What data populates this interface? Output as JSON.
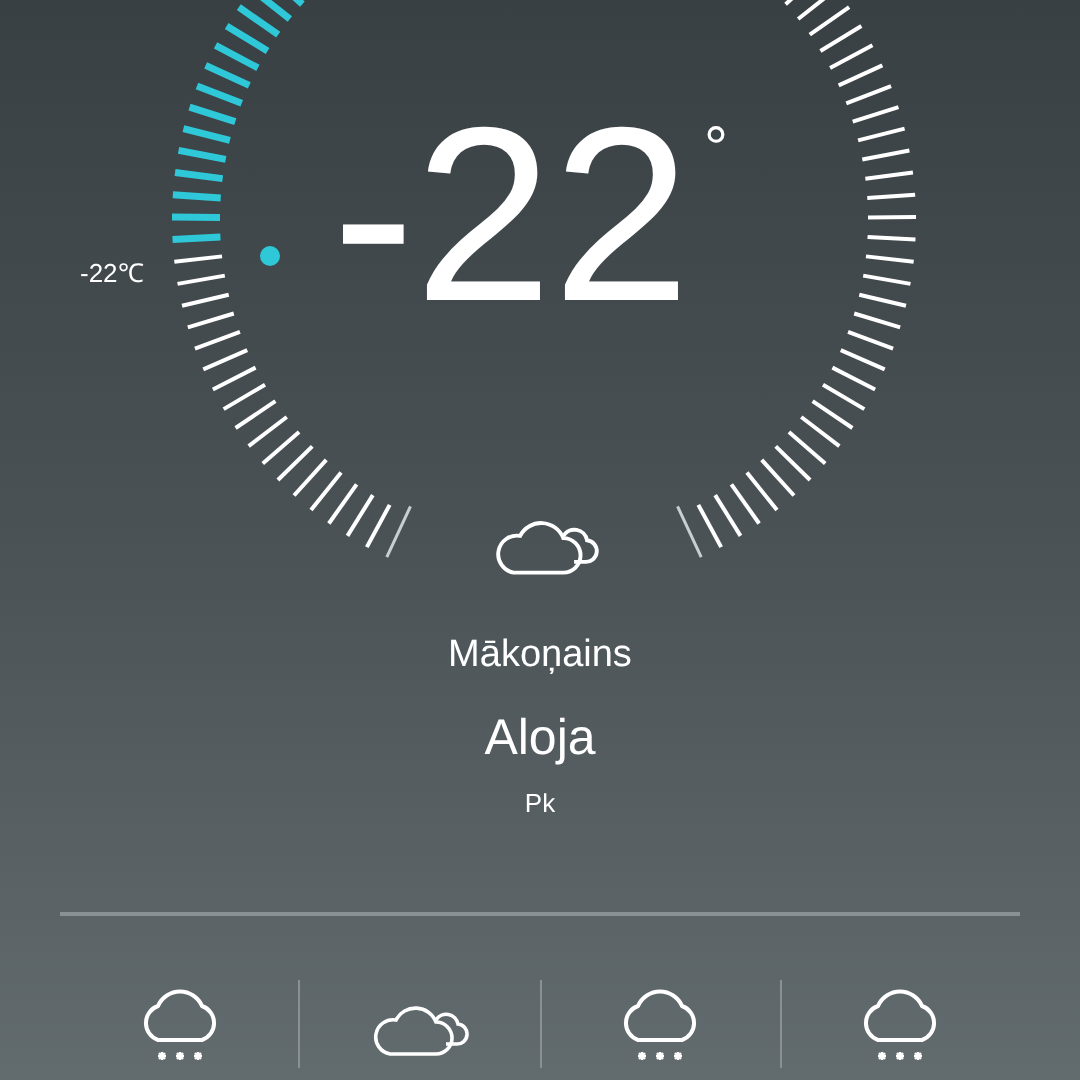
{
  "current": {
    "temperature": "-22",
    "unit": "°",
    "gauge_label": "-22℃",
    "condition": "Mākoņains",
    "city": "Aloja",
    "day": "Pk"
  },
  "forecast": [
    {
      "kind": "snow"
    },
    {
      "kind": "partly-cloudy"
    },
    {
      "kind": "snow"
    },
    {
      "kind": "snow"
    }
  ]
}
